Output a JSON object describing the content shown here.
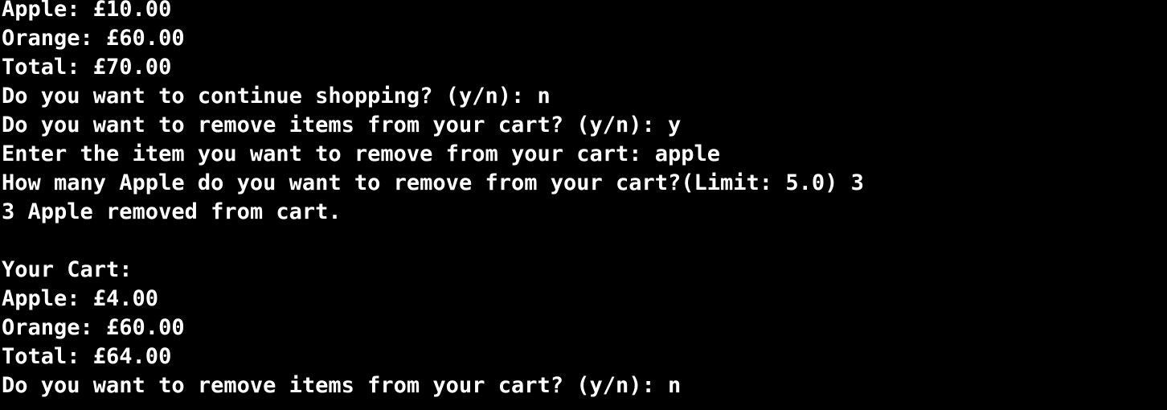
{
  "terminal": {
    "background": "#000000",
    "foreground": "#ffffff",
    "lines": [
      "Apple: £10.00",
      "Orange: £60.00",
      "Total: £70.00",
      "Do you want to continue shopping? (y/n): n",
      "Do you want to remove items from your cart? (y/n): y",
      "Enter the item you want to remove from your cart: apple",
      "How many Apple do you want to remove from your cart?(Limit: 5.0) 3",
      "3 Apple removed from cart.",
      "",
      "Your Cart:",
      "Apple: £4.00",
      "Orange: £60.00",
      "Total: £64.00",
      "Do you want to remove items from your cart? (y/n): n"
    ]
  }
}
